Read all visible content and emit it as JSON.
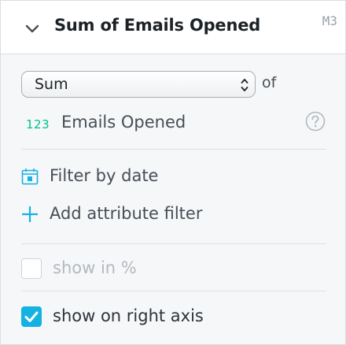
{
  "header": {
    "title": "Sum of Emails Opened",
    "badge": "M3"
  },
  "aggregation": {
    "selected": "Sum",
    "of_label": "of"
  },
  "measure": {
    "type_glyph": "123",
    "name": "Emails Opened"
  },
  "filters": {
    "date_label": "Filter by date",
    "add_attribute_label": "Add attribute filter"
  },
  "options": {
    "show_in_percent_label": "show in %",
    "show_in_percent_checked": false,
    "show_in_percent_disabled": true,
    "right_axis_label": "show on right axis",
    "right_axis_checked": true
  },
  "colors": {
    "accent": "#14b2e2",
    "numeric": "#00c18d",
    "text": "#464e56",
    "disabled_text": "#b3b9bf"
  },
  "icons": {
    "collapse": "chevron-down-icon",
    "help": "question-circle-icon",
    "date": "calendar-icon",
    "add": "plus-icon",
    "check": "checkmark-icon"
  }
}
